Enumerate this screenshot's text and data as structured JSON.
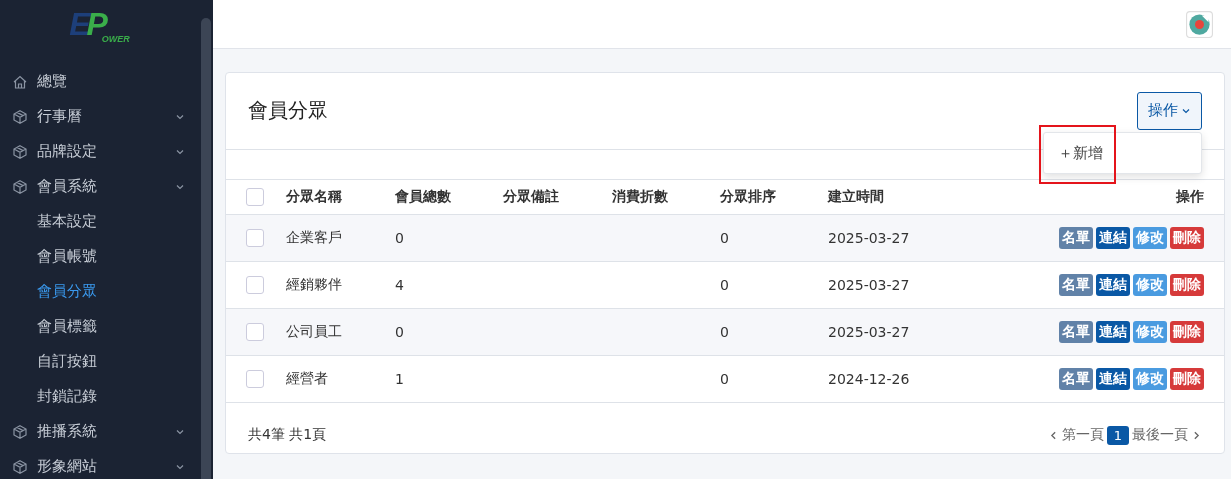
{
  "sidebar": {
    "logo": {
      "letters": "EP",
      "word": "OWER"
    },
    "items": [
      {
        "label": "總覽",
        "kind": "home",
        "selected": false
      },
      {
        "label": "行事曆",
        "kind": "box",
        "expandable": true,
        "expanded": false,
        "selected": false
      },
      {
        "label": "品牌設定",
        "kind": "box",
        "expandable": true,
        "expanded": false,
        "selected": false
      },
      {
        "label": "會員系統",
        "kind": "box",
        "expandable": true,
        "expanded": true,
        "selected": false,
        "children": [
          {
            "label": "基本設定",
            "selected": false
          },
          {
            "label": "會員帳號",
            "selected": false
          },
          {
            "label": "會員分眾",
            "selected": true
          },
          {
            "label": "會員標籤",
            "selected": false
          },
          {
            "label": "自訂按鈕",
            "selected": false
          },
          {
            "label": "封鎖記錄",
            "selected": false
          }
        ]
      },
      {
        "label": "推播系統",
        "kind": "box",
        "expandable": true,
        "expanded": false,
        "selected": false
      },
      {
        "label": "形象網站",
        "kind": "box",
        "expandable": true,
        "expanded": false,
        "selected": false
      }
    ]
  },
  "card": {
    "title": "會員分眾",
    "actions_button": "操作",
    "dropdown": {
      "items": [
        {
          "icon": "＋",
          "label": "新增"
        }
      ],
      "highlighted": true
    },
    "table": {
      "columns": [
        "分眾名稱",
        "會員總數",
        "分眾備註",
        "消費折數",
        "分眾排序",
        "建立時間",
        "操作"
      ],
      "header_checked": false,
      "rows": [
        {
          "checked": false,
          "cells": [
            "企業客戶",
            "0",
            "",
            "",
            "0",
            "2025-03-27"
          ],
          "actions": [
            {
              "label": "名單",
              "color": "#6182a8"
            },
            {
              "label": "連結",
              "color": "#0a58a5"
            },
            {
              "label": "修改",
              "color": "#4a9be0"
            },
            {
              "label": "刪除",
              "color": "#d63a3a"
            }
          ]
        },
        {
          "checked": false,
          "cells": [
            "經銷夥伴",
            "4",
            "",
            "",
            "0",
            "2025-03-27"
          ],
          "actions": [
            {
              "label": "名單",
              "color": "#6182a8"
            },
            {
              "label": "連結",
              "color": "#0a58a5"
            },
            {
              "label": "修改",
              "color": "#4a9be0"
            },
            {
              "label": "刪除",
              "color": "#d63a3a"
            }
          ]
        },
        {
          "checked": false,
          "cells": [
            "公司員工",
            "0",
            "",
            "",
            "0",
            "2025-03-27"
          ],
          "actions": [
            {
              "label": "名單",
              "color": "#6182a8"
            },
            {
              "label": "連結",
              "color": "#0a58a5"
            },
            {
              "label": "修改",
              "color": "#4a9be0"
            },
            {
              "label": "刪除",
              "color": "#d63a3a"
            }
          ]
        },
        {
          "checked": false,
          "cells": [
            "經營者",
            "1",
            "",
            "",
            "0",
            "2024-12-26"
          ],
          "actions": [
            {
              "label": "名單",
              "color": "#6182a8"
            },
            {
              "label": "連結",
              "color": "#0a58a5"
            },
            {
              "label": "修改",
              "color": "#4a9be0"
            },
            {
              "label": "刪除",
              "color": "#d63a3a"
            }
          ]
        }
      ]
    },
    "summary": "共4筆 共1頁",
    "pagination": {
      "first": "第一頁",
      "last": "最後一頁",
      "pages": [
        {
          "label": "1",
          "selected": true
        }
      ]
    }
  }
}
